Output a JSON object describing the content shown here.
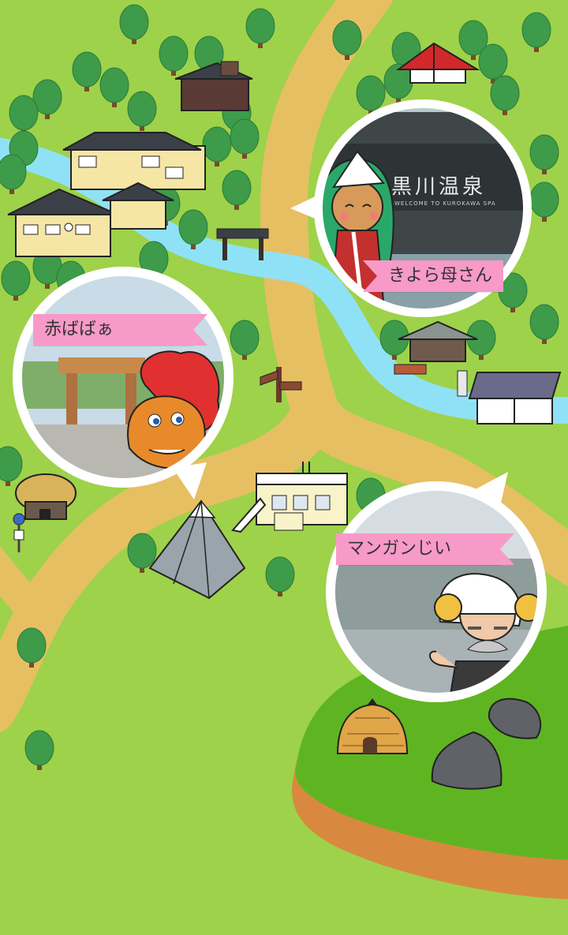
{
  "map": {
    "colors": {
      "grass": "#9ed24a",
      "grass_dark": "#5fb521",
      "road": "#e7bf63",
      "river": "#8fe2f5",
      "cliff": "#d8893f",
      "ribbon": "#f79ac8"
    }
  },
  "characters": [
    {
      "id": "kiyora",
      "label": "きよら母さん",
      "sign_text": "黒川温泉",
      "sign_sub": "WELCOME TO KUROKAWA SPA"
    },
    {
      "id": "akababa",
      "label": "赤ばばぁ"
    },
    {
      "id": "mangan",
      "label": "マンガンじい"
    }
  ],
  "icons": {
    "tree": "tree-icon",
    "house": "house-icon",
    "signpost": "signpost-icon",
    "mountain": "mountain-icon"
  }
}
